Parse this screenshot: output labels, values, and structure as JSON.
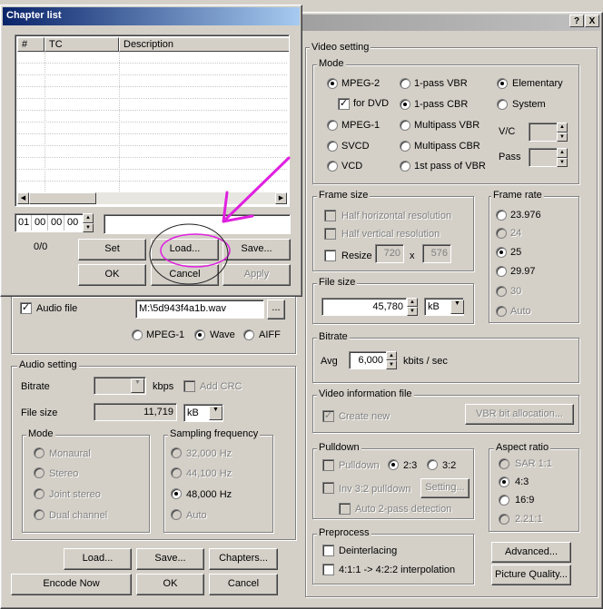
{
  "main_window": {
    "help_button": "?",
    "close_button": "X"
  },
  "video_setting": {
    "title": "Video setting",
    "mode": {
      "title": "Mode",
      "mpeg2": "MPEG-2",
      "for_dvd": "for DVD",
      "mpeg1": "MPEG-1",
      "svcd": "SVCD",
      "vcd": "VCD",
      "pass1_vbr": "1-pass VBR",
      "pass1_cbr": "1-pass CBR",
      "multipass_vbr": "Multipass VBR",
      "multipass_cbr": "Multipass CBR",
      "first_pass_vbr": "1st pass of VBR",
      "elementary": "Elementary",
      "system": "System",
      "vc_label": "V/C",
      "pass_label": "Pass"
    },
    "frame_size": {
      "title": "Frame size",
      "half_horizontal": "Half horizontal resolution",
      "half_vertical": "Half vertical resolution",
      "resize": "Resize",
      "width": "720",
      "x": "x",
      "height": "576"
    },
    "frame_rate": {
      "title": "Frame rate",
      "options": [
        "23.976",
        "24",
        "25",
        "29.97",
        "30",
        "Auto"
      ]
    },
    "file_size": {
      "title": "File size",
      "value": "45,780",
      "unit": "kB"
    },
    "bitrate": {
      "title": "Bitrate",
      "avg_label": "Avg",
      "value": "6,000",
      "unit": "kbits / sec"
    },
    "video_info_file": {
      "title": "Video information file",
      "create_new": "Create new",
      "vbr_button": "VBR bit allocation..."
    },
    "pulldown": {
      "title": "Pulldown",
      "pulldown": "Pulldown",
      "r23": "2:3",
      "r32": "3:2",
      "inv32": "Inv 3:2 pulldown",
      "setting": "Setting...",
      "auto_detect": "Auto 2-pass detection"
    },
    "aspect_ratio": {
      "title": "Aspect ratio",
      "options": [
        "SAR 1:1",
        "4:3",
        "16:9",
        "2.21:1"
      ]
    },
    "preprocess": {
      "title": "Preprocess",
      "deinterlacing": "Deinterlacing",
      "interpolation": "4:1:1 -> 4:2:2 interpolation"
    },
    "advanced_button": "Advanced...",
    "picture_quality_button": "Picture Quality..."
  },
  "audio_file": {
    "label": "Audio file",
    "path": "M:\\5d943f4a1b.wav",
    "browse": "...",
    "mpeg1": "MPEG-1",
    "wave": "Wave",
    "aiff": "AIFF"
  },
  "audio_setting": {
    "title": "Audio setting",
    "bitrate_label": "Bitrate",
    "kbps": "kbps",
    "add_crc": "Add CRC",
    "file_size_label": "File size",
    "file_size_value": "11,719",
    "file_size_unit": "kB",
    "mode": {
      "title": "Mode",
      "options": [
        "Monaural",
        "Stereo",
        "Joint stereo",
        "Dual channel"
      ]
    },
    "sampling": {
      "title": "Sampling frequency",
      "options": [
        "32,000 Hz",
        "44,100 Hz",
        "48,000 Hz",
        "Auto"
      ]
    }
  },
  "bottom_buttons": {
    "load": "Load...",
    "save": "Save...",
    "chapters": "Chapters...",
    "encode_now": "Encode Now",
    "ok": "OK",
    "cancel": "Cancel"
  },
  "chapter_list": {
    "title": "Chapter list",
    "columns": [
      "#",
      "TC",
      "Description"
    ],
    "tc_hh": "01",
    "tc_mm": "00",
    "tc_ss": "00",
    "tc_ff": "00",
    "count": "0/0",
    "set": "Set",
    "load": "Load...",
    "save": "Save...",
    "ok": "OK",
    "cancel": "Cancel",
    "apply": "Apply"
  },
  "colors": {
    "face": "#d4d0c8",
    "annotation": "#e020e0",
    "title_active": "#0a246a"
  }
}
